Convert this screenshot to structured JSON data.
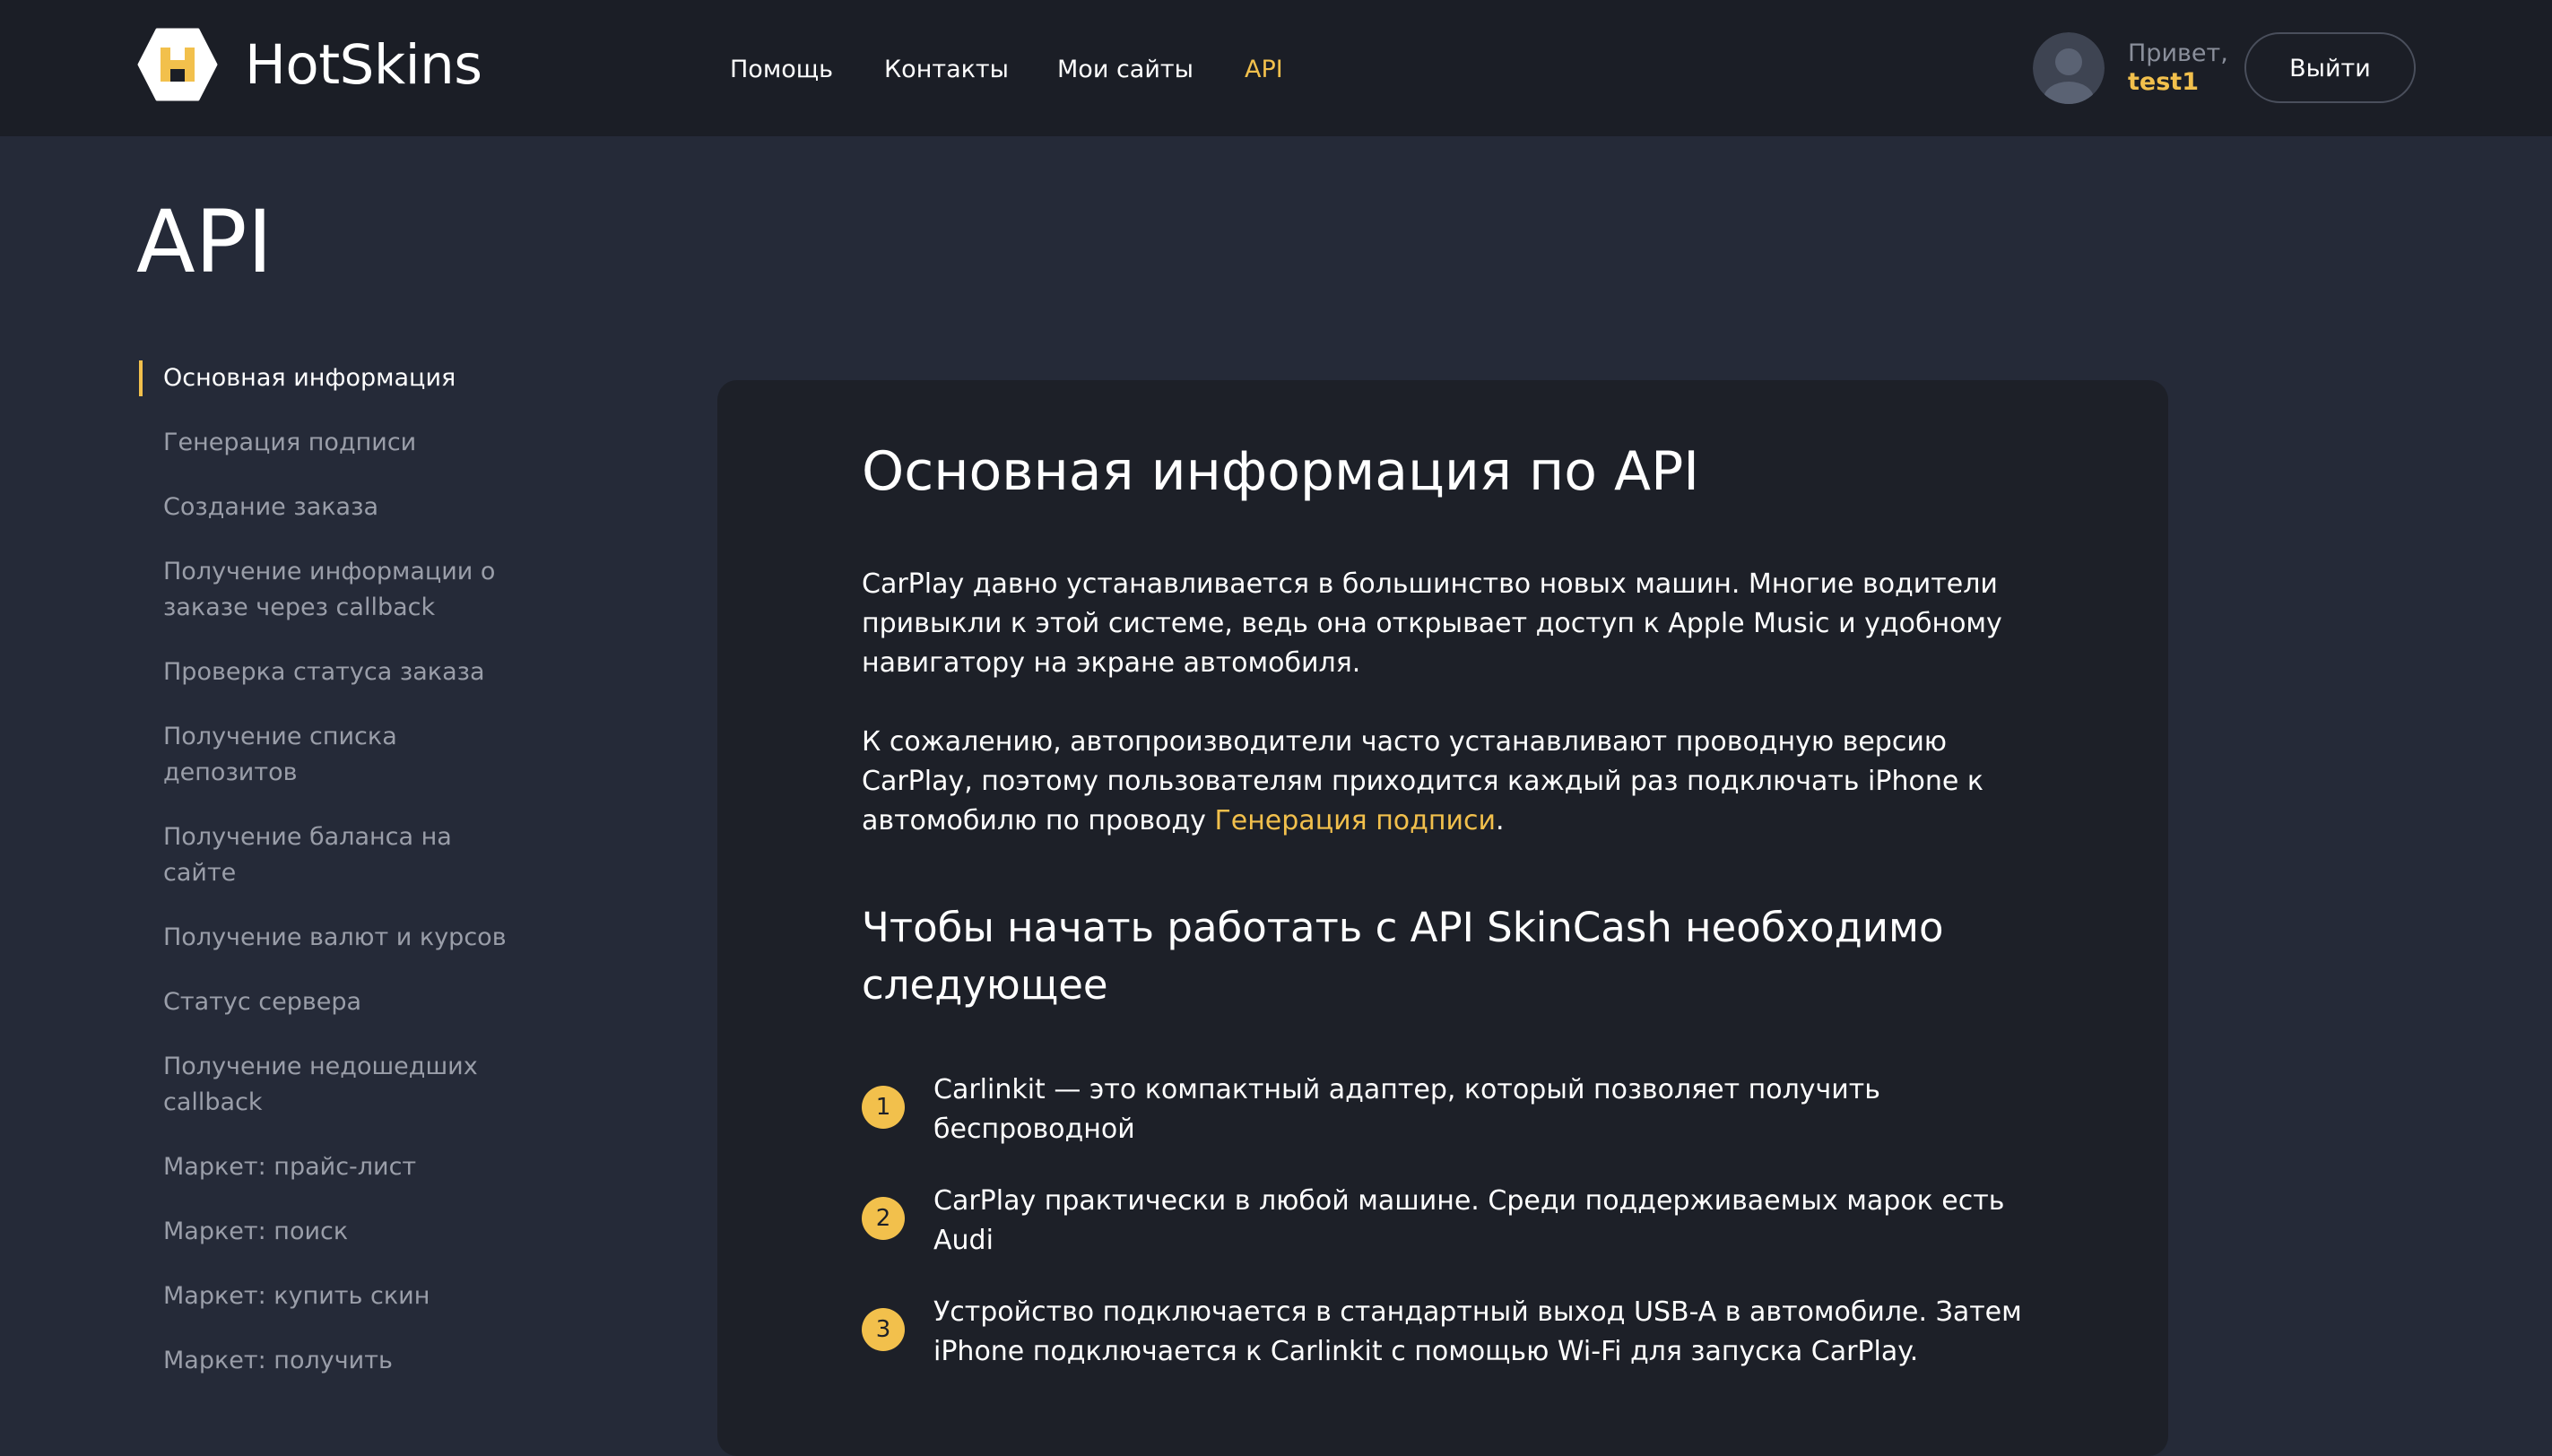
{
  "brand": {
    "name": "HotSkins",
    "accent_color": "#f2c04c"
  },
  "nav": {
    "items": [
      {
        "label": "Помощь"
      },
      {
        "label": "Контакты"
      },
      {
        "label": "Мои сайты"
      },
      {
        "label": "API",
        "active": true
      }
    ]
  },
  "user": {
    "greeting": "Привет,",
    "username": "test1",
    "logout_label": "Выйти",
    "avatar_icon": "user-avatar-icon"
  },
  "page": {
    "title": "API"
  },
  "sidebar": {
    "items": [
      {
        "label": "Основная информация",
        "active": true
      },
      {
        "label": "Генерация подписи"
      },
      {
        "label": "Создание заказа"
      },
      {
        "label": "Получение информации о заказе через callback"
      },
      {
        "label": "Проверка статуса заказа"
      },
      {
        "label": "Получение списка депозитов"
      },
      {
        "label": "Получение баланса на сайте"
      },
      {
        "label": "Получение валют и курсов"
      },
      {
        "label": "Статус сервера"
      },
      {
        "label": "Получение недошедших callback"
      },
      {
        "label": "Маркет: прайс-лист"
      },
      {
        "label": "Маркет: поиск"
      },
      {
        "label": "Маркет: купить скин"
      },
      {
        "label": "Маркет: получить"
      }
    ]
  },
  "content": {
    "heading": "Основная информация по API",
    "paragraph1": "CarPlay давно устанавливается в большинство новых машин. Многие водители привыкли к этой системе, ведь она открывает доступ к Apple Music и удобному навигатору на экране автомобиля.",
    "paragraph2_text": "К сожалению, автопроизводители часто устанавливают проводную версию CarPlay, поэтому пользователям приходится каждый раз подключать iPhone к автомобилю по проводу ",
    "paragraph2_link": "Генерация подписи",
    "paragraph2_end": ".",
    "subheading": "Чтобы начать работать с API SkinCash необходимо следующее",
    "steps": [
      {
        "num": "1",
        "text": "Carlinkit — это компактный адаптер, который позволяет получить беспроводной"
      },
      {
        "num": "2",
        "text": "CarPlay практически в любой машине. Среди поддерживаемых марок есть Audi"
      },
      {
        "num": "3",
        "text": "Устройство подключается в стандартный выход USB-A в автомобиле. Затем iPhone подключается к Carlinkit с помощью Wi-Fi для запуска CarPlay."
      }
    ]
  }
}
